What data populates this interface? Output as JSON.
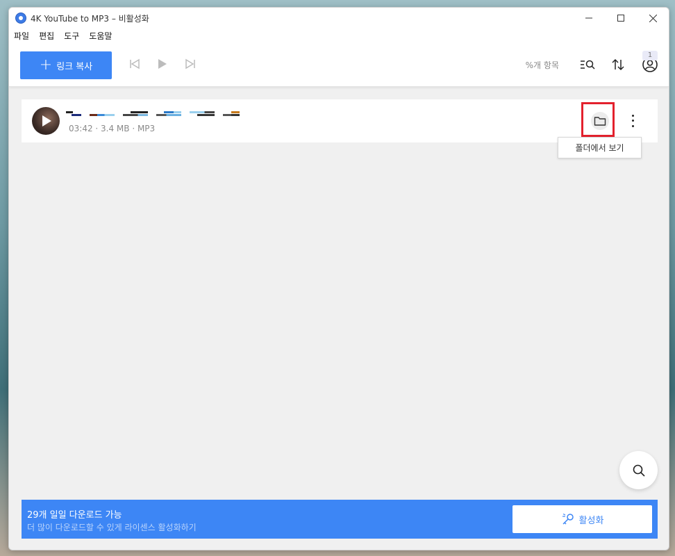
{
  "window": {
    "title": "4K YouTube to MP3 – 비활성화"
  },
  "menu": {
    "items": [
      "파일",
      "편집",
      "도구",
      "도움말"
    ]
  },
  "toolbar": {
    "paste_label": "링크 복사",
    "items_count": "%개 항목",
    "badge": "1"
  },
  "list": {
    "items": [
      {
        "meta": "03:42 · 3.4 MB · MP3"
      }
    ]
  },
  "tooltip": {
    "text": "폴더에서 보기"
  },
  "banner": {
    "title": "29개 일일 다운로드 가능",
    "subtitle": "더 많이 다운로드할 수 있게 라이센스 활성화하기",
    "activate_label": "활성화"
  },
  "colors": {
    "accent": "#3d86f5",
    "highlight": "#e3212d"
  },
  "icons": {
    "app": "app-logo-icon",
    "paste": "plus-icon",
    "prev": "skip-previous-icon",
    "play": "play-icon",
    "next": "skip-next-icon",
    "search_list": "search-list-icon",
    "sort": "sort-icon",
    "account": "account-icon",
    "folder": "folder-icon",
    "more": "more-vertical-icon",
    "search": "search-icon",
    "key": "key-icon"
  }
}
